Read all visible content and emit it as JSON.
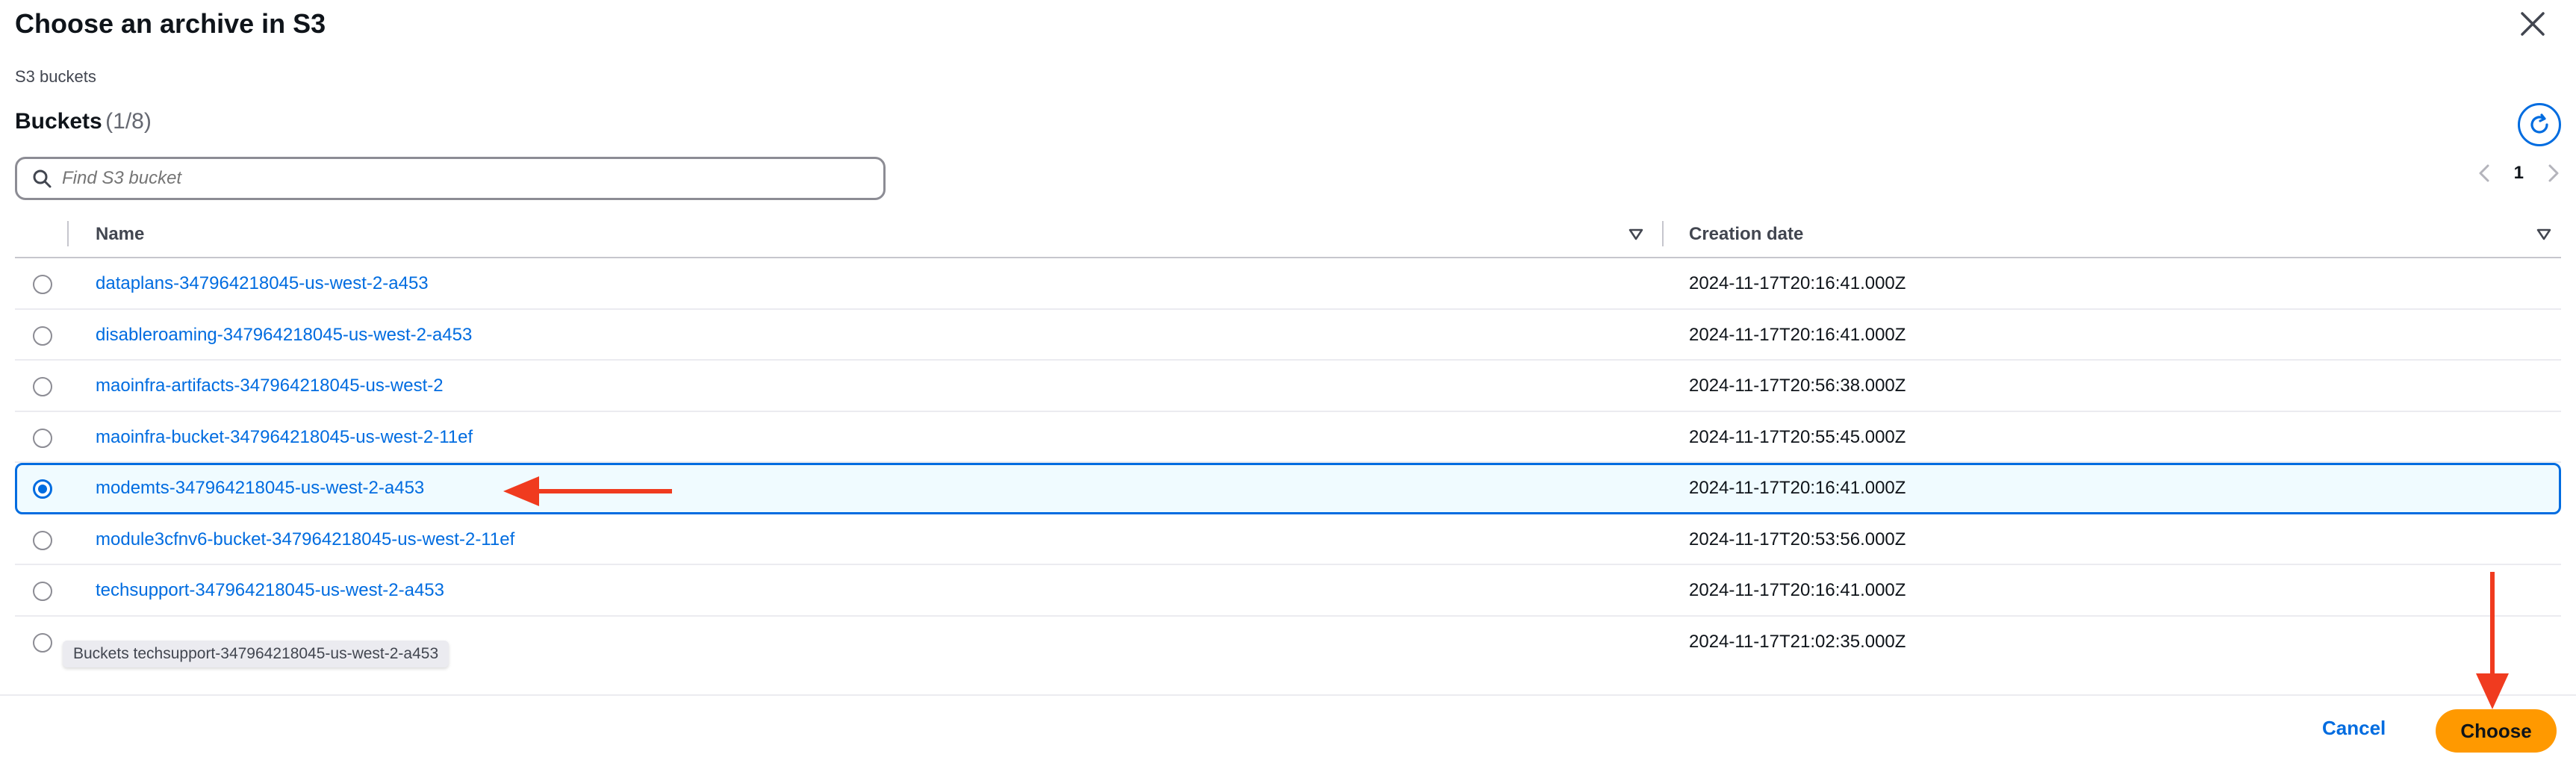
{
  "modal": {
    "title": "Choose an archive in S3",
    "breadcrumb": "S3 buckets"
  },
  "table": {
    "title": "Buckets",
    "count": "(1/8)",
    "search_placeholder": "Find S3 bucket",
    "page": "1",
    "columns": {
      "name": "Name",
      "date": "Creation date"
    },
    "rows": [
      {
        "name": "dataplans-347964218045-us-west-2-a453",
        "date": "2024-11-17T20:16:41.000Z",
        "selected": false
      },
      {
        "name": "disableroaming-347964218045-us-west-2-a453",
        "date": "2024-11-17T20:16:41.000Z",
        "selected": false
      },
      {
        "name": "maoinfra-artifacts-347964218045-us-west-2",
        "date": "2024-11-17T20:56:38.000Z",
        "selected": false
      },
      {
        "name": "maoinfra-bucket-347964218045-us-west-2-11ef",
        "date": "2024-11-17T20:55:45.000Z",
        "selected": false
      },
      {
        "name": "modemts-347964218045-us-west-2-a453",
        "date": "2024-11-17T20:16:41.000Z",
        "selected": true
      },
      {
        "name": "module3cfnv6-bucket-347964218045-us-west-2-11ef",
        "date": "2024-11-17T20:53:56.000Z",
        "selected": false
      },
      {
        "name": "techsupport-347964218045-us-west-2-a453",
        "date": "2024-11-17T20:16:41.000Z",
        "selected": false
      },
      {
        "name": "",
        "date": "2024-11-17T21:02:35.000Z",
        "selected": false
      }
    ]
  },
  "tooltip": "Buckets techsupport-347964218045-us-west-2-a453",
  "footer": {
    "cancel_label": "Cancel",
    "choose_label": "Choose"
  },
  "colors": {
    "link": "#006ce0",
    "primary_button": "#ff9900",
    "selected_row_bg": "#f0fbff",
    "annotation_arrow": "#f03b1f"
  },
  "icons": [
    "close-icon",
    "refresh-icon",
    "search-icon",
    "chevron-left-icon",
    "chevron-right-icon",
    "sort-down-icon"
  ]
}
